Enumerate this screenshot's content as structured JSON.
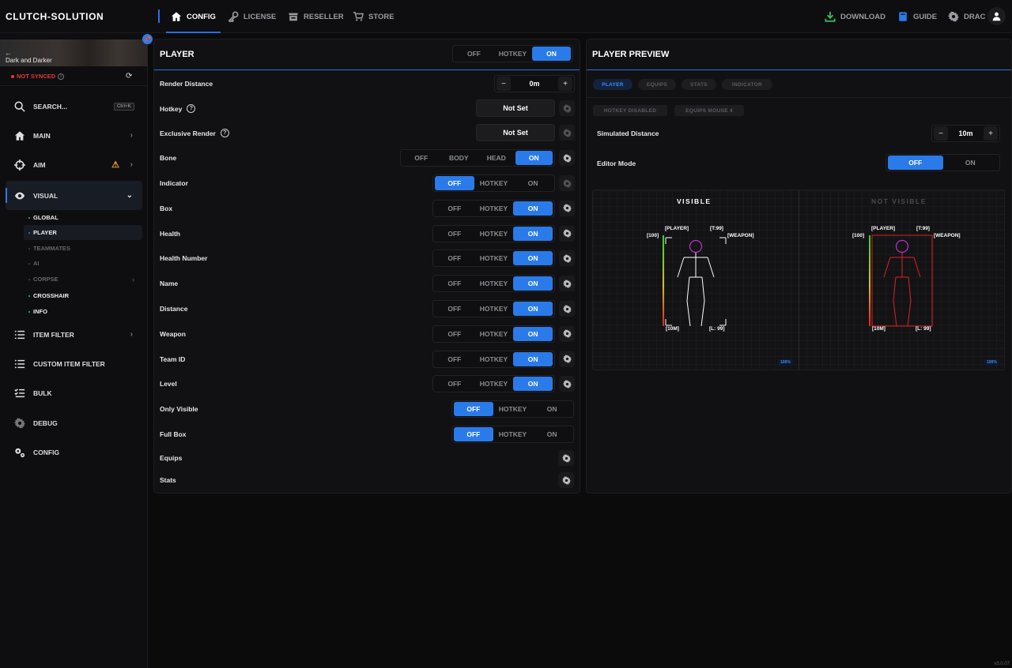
{
  "app": {
    "brand": "CLUTCH-SOLUTION",
    "version": "v3.0.07"
  },
  "topnav": {
    "tabs": [
      {
        "label": "CONFIG",
        "icon": "home-icon",
        "active": true
      },
      {
        "label": "LICENSE",
        "icon": "key-icon"
      },
      {
        "label": "RESELLER",
        "icon": "store-icon"
      },
      {
        "label": "STORE",
        "icon": "cart-icon"
      }
    ],
    "right": {
      "download": "DOWNLOAD",
      "guide": "GUIDE",
      "user": "DRAC"
    }
  },
  "sidebar": {
    "game": "Dark and Darker",
    "sync_status": "NOT SYNCED",
    "search": {
      "label": "SEARCH...",
      "shortcut": "Ctrl+K"
    },
    "items": [
      {
        "label": "MAIN",
        "icon": "home-icon"
      },
      {
        "label": "AIM",
        "icon": "crosshair-icon"
      },
      {
        "label": "VISUAL",
        "icon": "eye-icon",
        "active": true
      },
      {
        "label": "ITEM FILTER",
        "icon": "list-icon"
      },
      {
        "label": "CUSTOM ITEM FILTER",
        "icon": "list-icon"
      },
      {
        "label": "BULK",
        "icon": "checklist-icon"
      },
      {
        "label": "DEBUG",
        "icon": "gear-icon"
      },
      {
        "label": "CONFIG",
        "icon": "gears-icon"
      }
    ],
    "visual_sub": [
      {
        "label": "GLOBAL"
      },
      {
        "label": "PLAYER",
        "active": true
      },
      {
        "label": "TEAMMATES",
        "dim": true
      },
      {
        "label": "AI",
        "dim": true
      },
      {
        "label": "CORPSE",
        "dim": true
      },
      {
        "label": "CROSSHAIR"
      },
      {
        "label": "INFO"
      }
    ]
  },
  "player_panel": {
    "title": "PLAYER",
    "header_toggle": {
      "options": [
        "OFF",
        "HOTKEY",
        "ON"
      ],
      "selected": "ON"
    },
    "render_distance": {
      "label": "Render Distance",
      "value": "0m",
      "minus": "−",
      "plus": "+"
    },
    "hotkey": {
      "label": "Hotkey",
      "value": "Not Set"
    },
    "exclusive_render": {
      "label": "Exclusive Render",
      "value": "Not Set"
    },
    "bone": {
      "label": "Bone",
      "options": [
        "OFF",
        "BODY",
        "HEAD",
        "ON"
      ],
      "selected": "ON"
    },
    "rows": [
      {
        "label": "Indicator",
        "selected": "OFF"
      },
      {
        "label": "Box",
        "selected": "ON"
      },
      {
        "label": "Health",
        "selected": "ON"
      },
      {
        "label": "Health Number",
        "selected": "ON"
      },
      {
        "label": "Name",
        "selected": "ON"
      },
      {
        "label": "Distance",
        "selected": "ON"
      },
      {
        "label": "Weapon",
        "selected": "ON"
      },
      {
        "label": "Team ID",
        "selected": "ON"
      },
      {
        "label": "Level",
        "selected": "ON"
      }
    ],
    "rows2": [
      {
        "label": "Only Visible",
        "selected": "OFF"
      },
      {
        "label": "Full Box",
        "selected": "OFF"
      }
    ],
    "tri_options": [
      "OFF",
      "HOTKEY",
      "ON"
    ],
    "equips": "Equips",
    "stats": "Stats"
  },
  "preview_panel": {
    "title": "PLAYER PREVIEW",
    "tabs": [
      "PLAYER",
      "EQUIPS",
      "STATS",
      "INDICATOR"
    ],
    "tags": [
      "HOTKEY DISABLED",
      "EQUIPS MOUSE 4"
    ],
    "simulated_distance": {
      "label": "Simulated Distance",
      "value": "10m",
      "minus": "−",
      "plus": "+"
    },
    "editor_mode": {
      "label": "Editor Mode",
      "options": [
        "OFF",
        "ON"
      ],
      "selected": "OFF"
    },
    "visible": {
      "title": "VISIBLE",
      "health": "[100]",
      "name": "[PLAYER]",
      "team": "[T:99]",
      "weapon": "[WEAPON]",
      "distance": "[10M]",
      "level": "[L: 99]",
      "zoom": "100%"
    },
    "not_visible": {
      "title": "NOT VISIBLE",
      "health": "[100]",
      "name": "[PLAYER]",
      "team": "[T:99]",
      "weapon": "[WEAPON]",
      "distance": "[10M]",
      "level": "[L: 99]",
      "zoom": "100%"
    }
  },
  "colors": {
    "accent": "#2a7be9",
    "warning": "#f0a030",
    "not_synced": "#e03a3a",
    "skeleton_visible": "#ffffff",
    "skeleton_hidden": "#e02020",
    "head": "#c030d0"
  }
}
